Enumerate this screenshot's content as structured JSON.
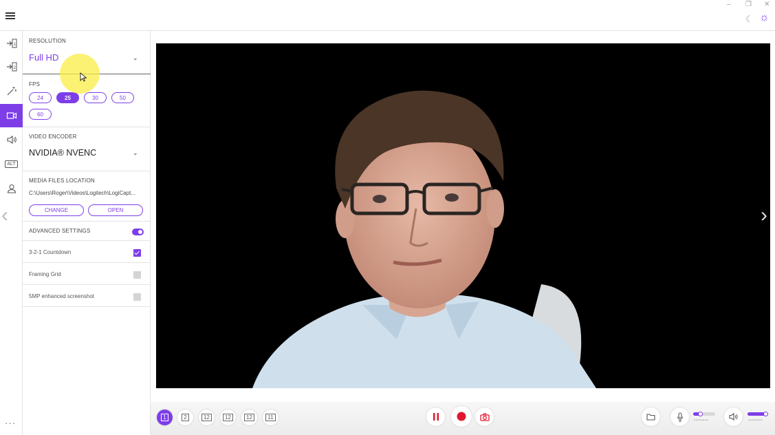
{
  "colors": {
    "accent": "#7d3ee8",
    "record": "#e0182d"
  },
  "window": {
    "minimize_icon": "minimize-icon",
    "restore_icon": "restore-icon",
    "close_icon": "close-icon",
    "minimize": "–",
    "restore": "❐",
    "close": "✕",
    "moon": "☾",
    "sun": "☼"
  },
  "settings": {
    "resolution": {
      "label": "RESOLUTION",
      "value": "Full HD"
    },
    "fps": {
      "label": "FPS",
      "options": [
        "24",
        "25",
        "30",
        "50",
        "60"
      ],
      "selected": "25"
    },
    "encoder": {
      "label": "VIDEO ENCODER",
      "value": "NVIDIA® NVENC"
    },
    "media": {
      "label": "MEDIA FILES LOCATION",
      "path": "C:\\Users\\Roger\\Videos\\Logitech\\LogiCapt...",
      "change": "CHANGE",
      "open": "OPEN"
    },
    "advanced": {
      "label": "ADVANCED SETTINGS",
      "enabled": true,
      "options": [
        {
          "label": "3-2-1 Countdown",
          "checked": true
        },
        {
          "label": "Framing Grid",
          "checked": false
        },
        {
          "label": "5MP enhanced screenshot",
          "checked": false
        }
      ]
    }
  },
  "rail": {
    "items": [
      "source-1-icon",
      "source-2-icon",
      "effects-wand-icon",
      "video-camera-icon",
      "speaker-icon",
      "alt-icon",
      "account-icon"
    ],
    "active": "video-camera-icon",
    "alt_label": "ALT",
    "more": "···"
  },
  "layouts": [
    "1",
    "2",
    "12",
    "12",
    "12",
    "11"
  ],
  "controls": {
    "pause": "pause-icon",
    "record": "record-icon",
    "screenshot": "camera-icon",
    "folder": "folder-icon",
    "mic": "microphone-icon",
    "volume": "speaker-icon"
  },
  "audio": {
    "mic_level": 0.3,
    "volume_level": 0.9,
    "meter": "▪▪▪▪▪▪▪▪"
  }
}
